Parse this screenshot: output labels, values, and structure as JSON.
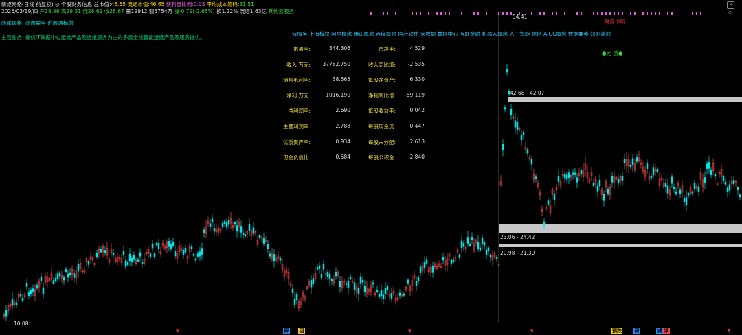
{
  "header": {
    "title": "新炬网络(日线 前复权)",
    "subtitle": "◎ 个股财务信息",
    "total_mv_label": "总市值:",
    "total_mv_value": "46.65",
    "float_mv_label": "流通市值:",
    "float_mv_value": "46.65",
    "profit_ratio_label": "获利盘比例:",
    "profit_ratio_value": "0.03",
    "avg_cost_label": "平均成本筹码:",
    "avg_cost_value": "31.51"
  },
  "quote": {
    "date": "2026/03/19/四",
    "open": "开28.96",
    "high": "高29.31",
    "low": "低28.69",
    "close": "收28.67",
    "volume": "量19912",
    "amount": "额5754万",
    "change": "幅-0.79(-2.65%)",
    "turnover": "换1.22%",
    "float_shares": "流通1.63亿",
    "industry": "其他云服务"
  },
  "company": {
    "style_label": "所属风格:",
    "style_value": "高市盈率  沪股通标的",
    "business_label": "主营业务:",
    "business_value": "提供IT数据中心运维产品及运维服务为主的多云全栈智能运维产品及服务提供。"
  },
  "concepts": "云服务  上海板块  阿里概念  腾讯概念  百度概念  国产软件  大数据  数据中心  互联金融  机器人概念  人工智能  信创  AIGC概念  数据要素  短剧游戏",
  "financials": {
    "left": [
      {
        "label": "市盈率:",
        "value": "344.306"
      },
      {
        "label": "收入 万元:",
        "value": "37782.750"
      },
      {
        "label": "销售毛利率:",
        "value": "38.565"
      },
      {
        "label": "净利 万元:",
        "value": "1016.190"
      },
      {
        "label": "净利润率:",
        "value": "2.690"
      },
      {
        "label": "主营利润率:",
        "value": "2.788"
      },
      {
        "label": "优质资产率:",
        "value": "0.934"
      },
      {
        "label": "现金负债比:",
        "value": "0.584"
      }
    ],
    "right": [
      {
        "label": "市净率:",
        "value": "4.529"
      },
      {
        "label": "收入同比增:",
        "value": "-2.535"
      },
      {
        "label": "每股净资产:",
        "value": "6.330"
      },
      {
        "label": "净利同比增:",
        "value": "-59.119"
      },
      {
        "label": "每股收益率:",
        "value": "0.042"
      },
      {
        "label": "每股现金流:",
        "value": "0.447"
      },
      {
        "label": "每股未分配:",
        "value": "2.613"
      },
      {
        "label": "每股公积金:",
        "value": "2.840"
      }
    ]
  },
  "right_panel": {
    "finance_title": "财务诊断:",
    "no_shareholder": "●无 质●",
    "high_price": "54.41",
    "band1": "42.68 - 42.07",
    "band2": "23.06 - 24.42",
    "band3": "20.98 - 21.39"
  },
  "low_price": "10.08",
  "bottom_markers": [
    {
      "text": "$",
      "color": "#ff4040"
    },
    {
      "text": "解",
      "color": "#1e90ff"
    },
    {
      "text": "回",
      "color": "#f0c040"
    },
    {
      "text": "$",
      "color": "#ff4040"
    },
    {
      "text": "$",
      "color": "#ff4040"
    },
    {
      "text": "预跌",
      "color": "#ffd700"
    },
    {
      "text": "研",
      "color": "#1e90ff"
    },
    {
      "text": "减",
      "color": "#1e90ff"
    },
    {
      "text": "净",
      "color": "#ff4040"
    },
    {
      "text": "$",
      "color": "#ff4040"
    }
  ],
  "colors": {
    "up": "#ff4d4d",
    "down": "#00e5e5",
    "accent_magenta": "#e05be0",
    "band_gray": "#c8c8c8"
  }
}
